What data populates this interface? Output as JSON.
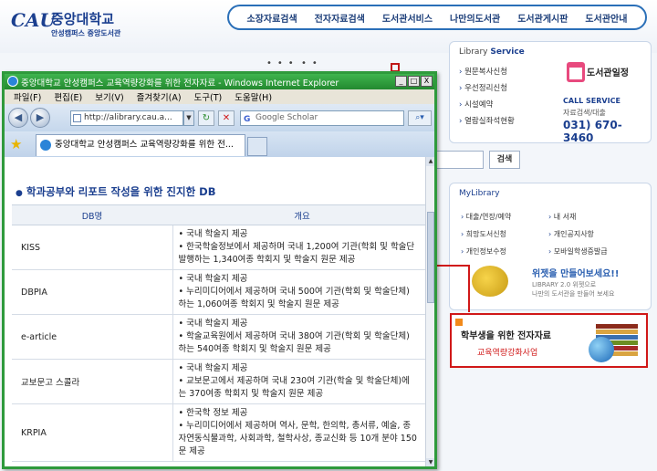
{
  "site": {
    "logo": {
      "mark": "CAU",
      "name": "중앙대학교",
      "sub": "안성캠퍼스 중앙도서관"
    },
    "nav": [
      "소장자료검색",
      "전자자료검색",
      "도서관서비스",
      "나만의도서관",
      "도서관게시판",
      "도서관안내"
    ],
    "service": {
      "title_prefix": "Library",
      "title_main": "Service",
      "items": [
        "원문복사신청",
        "우선정리신청",
        "시설예약",
        "열람실좌석현황"
      ],
      "calendar": "도서관일정",
      "call_label": "CALL SERVICE",
      "call_sub": "자료검색/대출",
      "call_number": "031) 670-3460"
    },
    "search_button": "검색",
    "mylibrary": {
      "title": "MyLibrary",
      "items": [
        "대출/연장/예약",
        "내 서재",
        "희망도서신청",
        "개인공지사항",
        "개인정보수정",
        "모바일학생증발급"
      ],
      "widget_title": "위젯을 만들어보세요!!",
      "widget_sub1": "LIBRARY 2.0  위젯으로",
      "widget_sub2": "나만의 도서관을 만들어 보세요"
    },
    "ebook": {
      "title": "학부생을 위한 전자자료",
      "subtitle": "교육역량강화사업"
    }
  },
  "ie": {
    "title": "중앙대학교 안성캠퍼스 교육역량강화를 위한 전자자료 - Windows Internet Explorer",
    "window_buttons": [
      "_",
      "□",
      "X"
    ],
    "menu": [
      "파일(F)",
      "편집(E)",
      "보기(V)",
      "즐겨찾기(A)",
      "도구(T)",
      "도움말(H)"
    ],
    "address": "http://alibrary.cau.a...",
    "search_placeholder": "Google Scholar",
    "tab_title": "중앙대학교 안성캠퍼스 교육역량강화를 위한 전...",
    "content": {
      "section_title": "학과공부와 리포트 작성을 위한 진지한 DB",
      "headers": [
        "DB명",
        "개요"
      ],
      "rows": [
        {
          "name": "KISS",
          "lines": [
            "• 국내 학술지 제공",
            "• 한국학술정보에서 제공하며 국내 1,200여 기관(학회 및 학술단",
            "발행하는 1,340여종 학회지 및 학술지 원문 제공"
          ]
        },
        {
          "name": "DBPIA",
          "lines": [
            "• 국내 학술지 제공",
            "• 누리미디어에서 제공하며 국내 500여 기관(학회 및 학술단체)",
            "하는 1,060여종 학회지 및 학술지 원문 제공"
          ]
        },
        {
          "name": "e-article",
          "lines": [
            "• 국내 학술지 제공",
            "• 학술교육원에서 제공하며 국내 380여 기관(학회 및 학술단체)",
            "하는 540여종 학회지 및 학술지 원문 제공"
          ]
        },
        {
          "name": "교보문고 스콜라",
          "lines": [
            "• 국내 학술지 제공",
            "• 교보문고에서 제공하며 국내 230여 기관(학술 및 학술단체)에",
            "는 370여종 학회지 및 학술지 원문 제공"
          ]
        },
        {
          "name": "KRPIA",
          "lines": [
            "• 한국학 정보 제공",
            "• 누리미디어에서 제공하며 역사, 문학, 한의학, 총서류, 예술, 종",
            "자연동식물과학, 사회과학, 철학사상, 종교신화 등 10개 분야 150",
            "문 제공"
          ]
        }
      ]
    }
  }
}
